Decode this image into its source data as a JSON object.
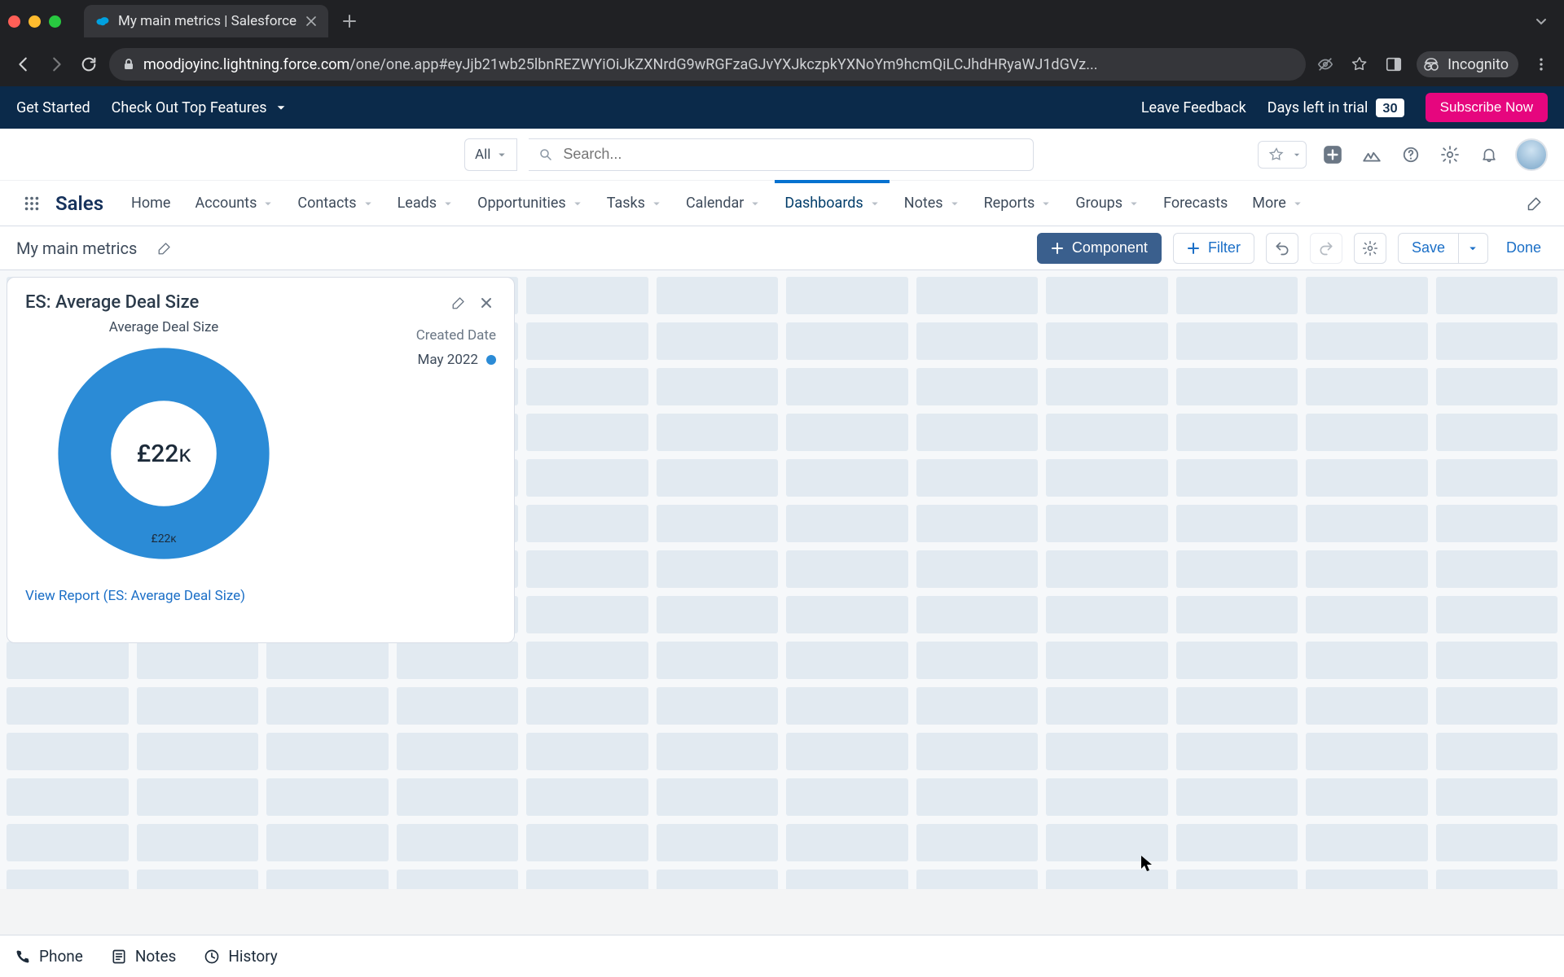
{
  "browser": {
    "tab_title": "My main metrics | Salesforce",
    "url_host": "moodjoyinc.lightning.force.com",
    "url_rest": "/one/one.app#eyJjb21wb25lbnREZWYiOiJkZXNrdG9wRGFzaGJvYXJkczpkYXNoYm9hcmQiLCJhdHRyaWJ1dGVz...",
    "incognito_label": "Incognito"
  },
  "trialbar": {
    "get_started": "Get Started",
    "top_features": "Check Out Top Features",
    "leave_feedback": "Leave Feedback",
    "days_label": "Days left in trial",
    "days_value": "30",
    "subscribe": "Subscribe Now"
  },
  "header": {
    "scope": "All",
    "search_placeholder": "Search..."
  },
  "nav": {
    "app": "Sales",
    "tabs": [
      "Home",
      "Accounts",
      "Contacts",
      "Leads",
      "Opportunities",
      "Tasks",
      "Calendar",
      "Dashboards",
      "Notes",
      "Reports",
      "Groups",
      "Forecasts",
      "More"
    ],
    "active_index": 7,
    "has_dropdown": [
      false,
      true,
      true,
      true,
      true,
      true,
      true,
      true,
      true,
      true,
      true,
      false,
      true
    ]
  },
  "toolbar": {
    "dashboard_title": "My main metrics",
    "component": "Component",
    "filter": "Filter",
    "save": "Save",
    "done": "Done"
  },
  "widget": {
    "title": "ES: Average Deal Size",
    "chart_label": "Average Deal Size",
    "legend_title": "Created Date",
    "legend_item": "May 2022",
    "center_value": "£22ᴋ",
    "slice_label": "£22ᴋ",
    "view_report": "View Report (ES: Average Deal Size)"
  },
  "chart_data": {
    "type": "pie",
    "title": "Average Deal Size",
    "series_label": "Created Date",
    "categories": [
      "May 2022"
    ],
    "values": [
      22000
    ],
    "display_values": [
      "£22k"
    ],
    "center_metric": "£22k",
    "colors": [
      "#2b8bd6"
    ]
  },
  "dock": {
    "phone": "Phone",
    "notes": "Notes",
    "history": "History"
  }
}
